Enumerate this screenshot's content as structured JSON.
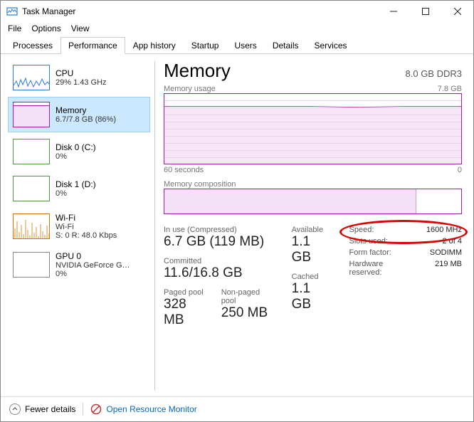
{
  "window": {
    "title": "Task Manager"
  },
  "menu": {
    "file": "File",
    "options": "Options",
    "view": "View"
  },
  "tabs": {
    "processes": "Processes",
    "performance": "Performance",
    "app_history": "App history",
    "startup": "Startup",
    "users": "Users",
    "details": "Details",
    "services": "Services"
  },
  "sidebar": {
    "cpu": {
      "title": "CPU",
      "sub": "29% 1.43 GHz"
    },
    "memory": {
      "title": "Memory",
      "sub": "6.7/7.8 GB (86%)"
    },
    "disk0": {
      "title": "Disk 0 (C:)",
      "sub": "0%"
    },
    "disk1": {
      "title": "Disk 1 (D:)",
      "sub": "0%"
    },
    "wifi": {
      "title": "Wi-Fi",
      "sub1": "Wi-Fi",
      "sub2": "S: 0 R: 48.0 Kbps"
    },
    "gpu": {
      "title": "GPU 0",
      "sub": "NVIDIA GeForce G…",
      "sub2": "0%"
    }
  },
  "main": {
    "heading": "Memory",
    "capacity": "8.0 GB DDR3",
    "usage_label": "Memory usage",
    "usage_max": "7.8 GB",
    "axis_left": "60 seconds",
    "axis_right": "0",
    "comp_label": "Memory composition",
    "stats": {
      "inuse_lbl": "In use (Compressed)",
      "inuse_val": "6.7 GB (119 MB)",
      "available_lbl": "Available",
      "available_val": "1.1 GB",
      "committed_lbl": "Committed",
      "committed_val": "11.6/16.8 GB",
      "cached_lbl": "Cached",
      "cached_val": "1.1 GB",
      "paged_lbl": "Paged pool",
      "paged_val": "328 MB",
      "nonpaged_lbl": "Non-paged pool",
      "nonpaged_val": "250 MB"
    },
    "mini": {
      "speed_lbl": "Speed:",
      "speed_val": "1600 MHz",
      "slots_lbl": "Slots used:",
      "slots_val": "2 of 4",
      "form_lbl": "Form factor:",
      "form_val": "SODIMM",
      "hw_lbl": "Hardware reserved:",
      "hw_val": "219 MB"
    }
  },
  "footer": {
    "fewer": "Fewer details",
    "orm": "Open Resource Monitor"
  },
  "chart_data": {
    "type": "line",
    "title": "Memory usage",
    "xlabel": "seconds",
    "ylabel": "GB",
    "x_range_seconds": [
      60,
      0
    ],
    "ylim": [
      0,
      7.8
    ],
    "series": [
      {
        "name": "Memory",
        "values_gb_approx": 6.7,
        "note": "roughly flat ~86% across window"
      }
    ]
  }
}
